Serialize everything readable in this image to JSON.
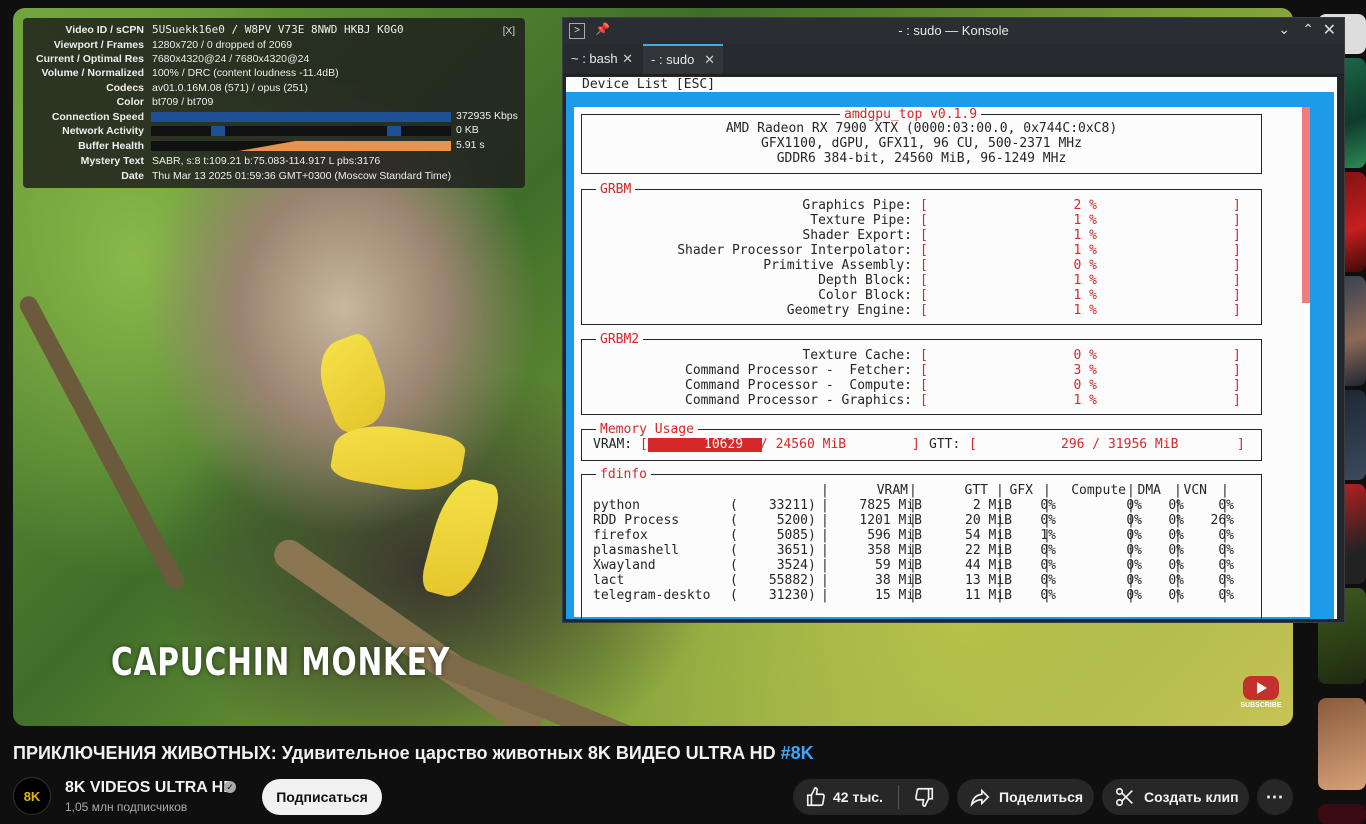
{
  "stats": {
    "close_label": "[X]",
    "rows": [
      {
        "k": "Video ID / sCPN",
        "v": "5USuekk16e0  /  W8PV V73E 8NWD HKBJ K0G0"
      },
      {
        "k": "Viewport / Frames",
        "v": "1280x720 / 0 dropped of 2069"
      },
      {
        "k": "Current / Optimal Res",
        "v": "7680x4320@24 / 7680x4320@24"
      },
      {
        "k": "Volume / Normalized",
        "v": "100% / DRC (content loudness -11.4dB)"
      },
      {
        "k": "Codecs",
        "v": "av01.0.16M.08 (571) / opus (251)"
      },
      {
        "k": "Color",
        "v": "bt709 / bt709"
      },
      {
        "k": "Connection Speed",
        "v": "372935 Kbps"
      },
      {
        "k": "Network Activity",
        "v": "0 KB"
      },
      {
        "k": "Buffer Health",
        "v": "5.91 s"
      },
      {
        "k": "Mystery Text",
        "v": "SABR, s:8 t:109.21 b:75.083-114.917 L pbs:3176"
      },
      {
        "k": "Date",
        "v": "Thu Mar 13 2025 01:59:36 GMT+0300 (Moscow Standard Time)"
      }
    ]
  },
  "video": {
    "caption": "CAPUCHIN MONKEY",
    "watermark_label": "SUBSCRIBE",
    "title": "ПРИКЛЮЧЕНИЯ ЖИВОТНЫХ: Удивительное царство животных 8K ВИДЕО ULTRA HD",
    "title_tag": "#8K"
  },
  "channel": {
    "avatar_text": "8K",
    "name": "8K VIDEOS ULTRA HD",
    "subscribers": "1,05 млн подписчиков",
    "subscribe_label": "Подписаться"
  },
  "actions": {
    "likes": "42 тыс.",
    "share": "Поделиться",
    "clip": "Создать клип"
  },
  "konsole": {
    "title": "- : sudo — Konsole",
    "tabs": [
      {
        "label": "~ : bash"
      },
      {
        "label": "- : sudo"
      }
    ],
    "header_line": "Device List [ESC]",
    "app_title": "amdgpu_top v0.1.9",
    "device_lines": [
      "AMD Radeon RX 7900 XTX (0000:03:00.0, 0x744C:0xC8)",
      "GFX1100, dGPU, GFX11, 96 CU, 500-2371 MHz",
      "GDDR6 384-bit, 24560 MiB, 96-1249 MHz"
    ],
    "grbm_title": "GRBM",
    "grbm": [
      {
        "label": "Graphics Pipe:",
        "pct": "2 %"
      },
      {
        "label": "Texture Pipe:",
        "pct": "1 %"
      },
      {
        "label": "Shader Export:",
        "pct": "1 %"
      },
      {
        "label": "Shader Processor Interpolator:",
        "pct": "1 %"
      },
      {
        "label": "Primitive Assembly:",
        "pct": "0 %"
      },
      {
        "label": "Depth Block:",
        "pct": "1 %"
      },
      {
        "label": "Color Block:",
        "pct": "1 %"
      },
      {
        "label": "Geometry Engine:",
        "pct": "1 %"
      }
    ],
    "grbm2_title": "GRBM2",
    "grbm2": [
      {
        "label": "Texture Cache:",
        "pct": "0 %"
      },
      {
        "label": "Command Processor -  Fetcher:",
        "pct": "3 %"
      },
      {
        "label": "Command Processor -  Compute:",
        "pct": "0 %"
      },
      {
        "label": "Command Processor - Graphics:",
        "pct": "1 %"
      }
    ],
    "memory_title": "Memory Usage",
    "vram_label": "VRAM:",
    "vram_used": "10629",
    "vram_total": "/ 24560 MiB",
    "vram_fraction": 0.43,
    "gtt_label": "GTT:",
    "gtt_value": "296 / 31956 MiB",
    "fdinfo_title": "fdinfo",
    "fdinfo_headers": [
      "VRAM",
      "GTT",
      "GFX",
      "Compute",
      "DMA",
      "VCN"
    ],
    "processes": [
      {
        "name": "python",
        "pid": "33211",
        "vram": "7825 MiB",
        "gtt": "2 MiB",
        "gfx": "0%",
        "compute": "0%",
        "dma": "0%",
        "vcn": "0%"
      },
      {
        "name": "RDD Process",
        "pid": "5200",
        "vram": "1201 MiB",
        "gtt": "20 MiB",
        "gfx": "0%",
        "compute": "0%",
        "dma": "0%",
        "vcn": "26%"
      },
      {
        "name": "firefox",
        "pid": "5085",
        "vram": "596 MiB",
        "gtt": "54 MiB",
        "gfx": "1%",
        "compute": "0%",
        "dma": "0%",
        "vcn": "0%"
      },
      {
        "name": "plasmashell",
        "pid": "3651",
        "vram": "358 MiB",
        "gtt": "22 MiB",
        "gfx": "0%",
        "compute": "0%",
        "dma": "0%",
        "vcn": "0%"
      },
      {
        "name": "Xwayland",
        "pid": "3524",
        "vram": "59 MiB",
        "gtt": "44 MiB",
        "gfx": "0%",
        "compute": "0%",
        "dma": "0%",
        "vcn": "0%"
      },
      {
        "name": "lact",
        "pid": "55882",
        "vram": "38 MiB",
        "gtt": "13 MiB",
        "gfx": "0%",
        "compute": "0%",
        "dma": "0%",
        "vcn": "0%"
      },
      {
        "name": "telegram-deskto",
        "pid": "31230",
        "vram": "15 MiB",
        "gtt": "11 MiB",
        "gfx": "0%",
        "compute": "0%",
        "dma": "0%",
        "vcn": "0%"
      }
    ]
  },
  "colors": {
    "accent_blue": "#3ea6ff",
    "term_blue": "#1e9be8",
    "term_red": "#d62828"
  }
}
